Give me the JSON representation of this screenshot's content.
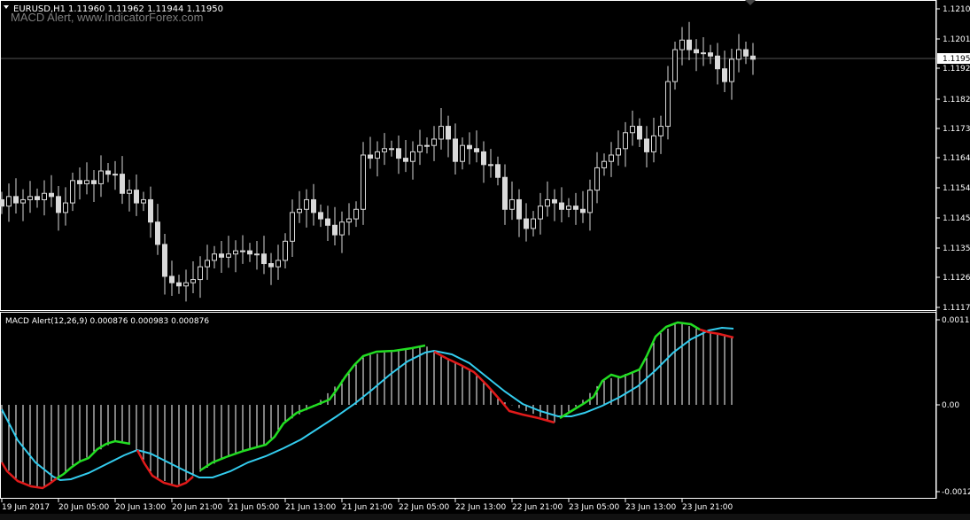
{
  "window": {
    "symbol_period": "EURUSD,H1",
    "ohlc": "1.11960 1.11962 1.11944 1.11950",
    "watermark": "MACD Alert, www.IndicatorForex.com"
  },
  "colors": {
    "background": "#000000",
    "border": "#ffffff",
    "candle": "#d9d9d9",
    "bid_line": "#6e6e6e",
    "macd_up": "#22dd22",
    "macd_down": "#e11a1a",
    "signal": "#33ccee",
    "histogram": "#ffffff"
  },
  "main_window": {
    "current_price": "1.11950",
    "price_ticks": [
      "1.12105",
      "1.12015",
      "1.11920",
      "1.11825",
      "1.11730",
      "1.11640",
      "1.11545",
      "1.11450",
      "1.11355",
      "1.11265",
      "1.11170"
    ]
  },
  "indicator_window": {
    "title": "MACD Alert(12,26,9) 0.000876 0.000983 0.000876",
    "ticks": [
      "0.00117",
      "0.00",
      "-0.00122"
    ]
  },
  "time_axis": {
    "labels": [
      "19 Jun 2017",
      "20 Jun 05:00",
      "20 Jun 13:00",
      "20 Jun 21:00",
      "21 Jun 05:00",
      "21 Jun 13:00",
      "21 Jun 21:00",
      "22 Jun 05:00",
      "22 Jun 13:00",
      "22 Jun 21:00",
      "23 Jun 05:00",
      "23 Jun 13:00",
      "23 Jun 21:00"
    ]
  },
  "chart_data": {
    "type": "candlestick",
    "symbol": "EURUSD",
    "timeframe": "H1",
    "price_range": [
      1.1117,
      1.1213
    ],
    "candles_close": [
      1.1149,
      1.1152,
      1.115,
      1.1151,
      1.1152,
      1.1151,
      1.1153,
      1.1152,
      1.1147,
      1.115,
      1.1157,
      1.1156,
      1.1157,
      1.1156,
      1.116,
      1.1159,
      1.1159,
      1.1153,
      1.1154,
      1.115,
      1.1151,
      1.1144,
      1.1137,
      1.1127,
      1.1125,
      1.1124,
      1.1125,
      1.1126,
      1.113,
      1.1132,
      1.1134,
      1.1133,
      1.1134,
      1.1135,
      1.1135,
      1.1134,
      1.1134,
      1.1131,
      1.113,
      1.1132,
      1.1138,
      1.1147,
      1.1148,
      1.1151,
      1.1147,
      1.1145,
      1.1143,
      1.114,
      1.1144,
      1.1145,
      1.1148,
      1.1165,
      1.1164,
      1.1166,
      1.1167,
      1.1167,
      1.1164,
      1.1163,
      1.1166,
      1.1168,
      1.1168,
      1.117,
      1.1174,
      1.117,
      1.1163,
      1.1168,
      1.1167,
      1.1166,
      1.1162,
      1.1162,
      1.1158,
      1.1148,
      1.1151,
      1.1145,
      1.1142,
      1.1145,
      1.1149,
      1.1151,
      1.115,
      1.1148,
      1.1149,
      1.1148,
      1.1147,
      1.1154,
      1.1161,
      1.1163,
      1.1165,
      1.1167,
      1.1172,
      1.1174,
      1.117,
      1.1166,
      1.1171,
      1.1174,
      1.1188,
      1.1198,
      1.1201,
      1.1198,
      1.1197,
      1.1197,
      1.1196,
      1.1192,
      1.1188,
      1.1195,
      1.1198,
      1.1196,
      1.1195
    ]
  }
}
